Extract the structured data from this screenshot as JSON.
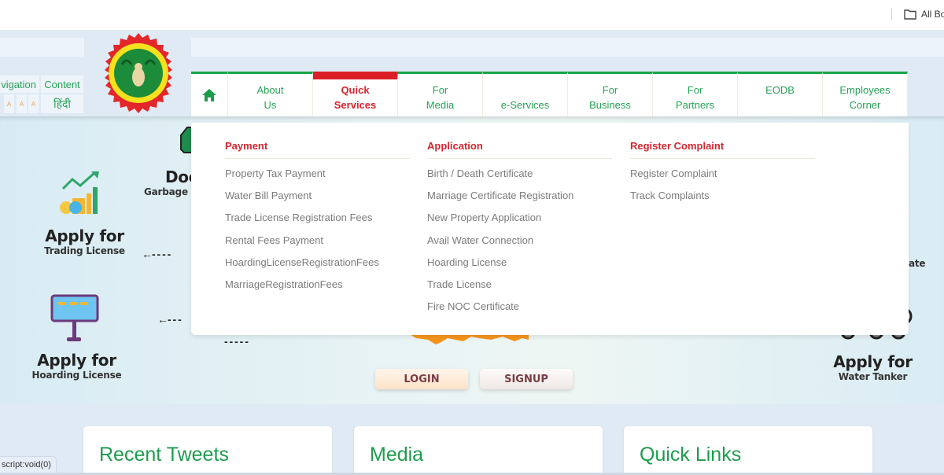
{
  "browser": {
    "bookmarks_label": "All Bo",
    "bookmarks_icon": "folder-icon"
  },
  "accessibility": {
    "skip_navigation": "vigation",
    "skip_content": "Content",
    "font_sizes": [
      "A",
      "A",
      "A"
    ],
    "language": "हिंदी"
  },
  "emblem": {
    "alt": "Madhya Pradesh state emblem"
  },
  "nav": {
    "home_icon": "home-icon",
    "items": [
      {
        "line1": "About",
        "line2": "Us"
      },
      {
        "line1": "Quick",
        "line2": "Services",
        "active": true
      },
      {
        "line1": "For",
        "line2": "Media"
      },
      {
        "line1": "",
        "line2": "e-Services"
      },
      {
        "line1": "For",
        "line2": "Business"
      },
      {
        "line1": "For",
        "line2": "Partners"
      },
      {
        "line1": "EODB",
        "line2": ""
      },
      {
        "line1": "Employees",
        "line2": "Corner"
      }
    ]
  },
  "mega_menu": {
    "columns": [
      {
        "heading": "Payment",
        "links": [
          "Property Tax Payment",
          "Water Bill Payment",
          "Trade License Registration Fees",
          "Rental Fees Payment",
          "HoardingLicenseRegistrationFees",
          "MarriageRegistrationFees"
        ]
      },
      {
        "heading": "Application",
        "links": [
          "Birth / Death Certificate",
          "Marriage Certificate Registration",
          "New Property Application",
          "Avail Water Connection",
          "Hoarding License",
          "Trade License",
          "Fire NOC Certificate"
        ]
      },
      {
        "heading": "Register Complaint",
        "links": [
          "Register Complaint",
          "Track Complaints"
        ]
      }
    ]
  },
  "hero": {
    "services": [
      {
        "title": "Apply for",
        "subtitle": "Trading License"
      },
      {
        "title": "Apply for",
        "subtitle": "Hoarding License"
      },
      {
        "title": "Apply for",
        "subtitle": "Water Tanker"
      },
      {
        "title": "Doo",
        "subtitle": "Garbage"
      },
      {
        "title": "",
        "subtitle": "ate"
      }
    ],
    "login_label": "LOGIN",
    "signup_label": "SIGNUP"
  },
  "cards": [
    "Recent Tweets",
    "Media",
    "Quick Links"
  ],
  "status_bar": "script:void(0)",
  "colors": {
    "brand_green": "#1aa34a",
    "active_red": "#dc1f26",
    "heading_red": "#d8262d",
    "link_gray": "#7b7b7b"
  }
}
